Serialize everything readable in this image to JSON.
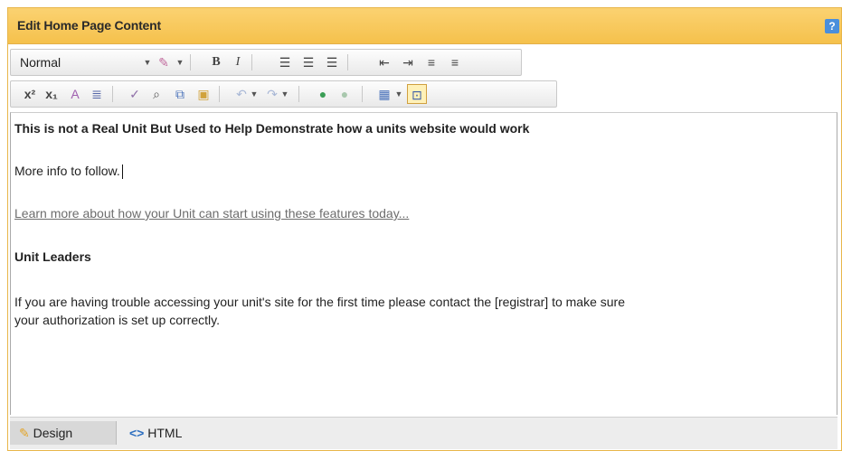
{
  "header": {
    "title": "Edit Home Page Content",
    "help_label": "?"
  },
  "toolbar1": {
    "format_value": "Normal",
    "format_options_icon": "dropdown-icon",
    "buttons": [
      "paint-icon",
      "bold-icon",
      "italic-icon",
      "align-left-icon",
      "align-center-icon",
      "align-right-icon",
      "outdent-icon",
      "indent-icon",
      "ordered-list-icon",
      "unordered-list-icon"
    ]
  },
  "toolbar2": {
    "buttons": [
      "superscript-icon",
      "subscript-icon",
      "clear-format-icon",
      "paragraph-icon",
      "spellcheck-icon",
      "find-icon",
      "copy-icon",
      "paste-icon",
      "undo-icon",
      "redo-icon",
      "link-icon",
      "unlink-icon",
      "table-icon",
      "toggle-html-icon"
    ]
  },
  "editor": {
    "line1": "This is not a Real Unit But Used to Help Demonstrate how a units website would work",
    "line2": "More info to follow.",
    "link_text": "Learn more about how your Unit can start using these features today...",
    "heading": "Unit Leaders",
    "para_line1": "If you are having trouble accessing your unit's site for the first time please contact the [registrar] to make sure",
    "para_line2": "your authorization is set up correctly."
  },
  "modes": {
    "design_label": "Design",
    "html_label": "HTML"
  },
  "colors": {
    "header_bg": "#f5c14c",
    "help_bg": "#4a8fdc"
  }
}
